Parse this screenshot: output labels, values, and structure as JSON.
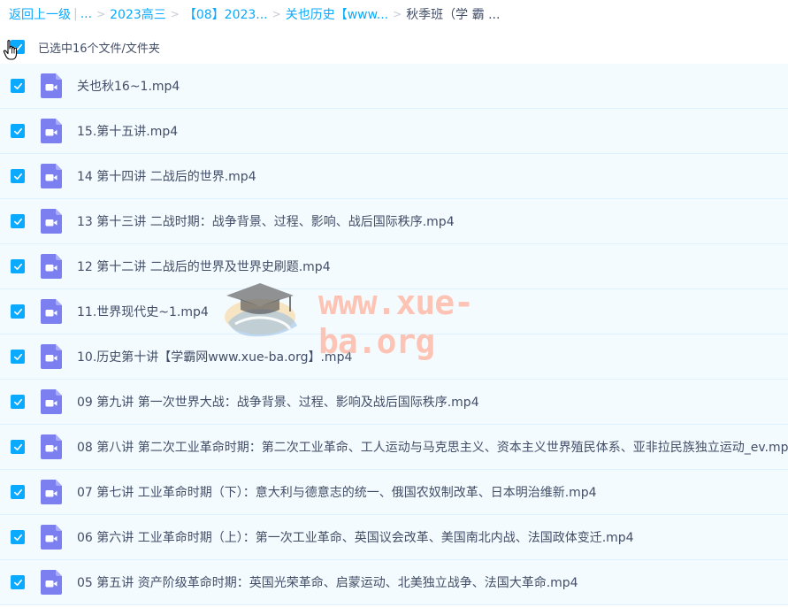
{
  "breadcrumb": {
    "back_label": "返回上一级",
    "ellipsis": "...",
    "items": [
      "2023高三",
      "【08】2023...",
      "关也历史【www..."
    ],
    "current": "秋季班（学 霸 ..."
  },
  "selection": {
    "label": "已选中16个文件/文件夹"
  },
  "files": [
    {
      "name": "关也秋16~1.mp4"
    },
    {
      "name": "15.第十五讲.mp4"
    },
    {
      "name": "14 第十四讲 二战后的世界.mp4"
    },
    {
      "name": "13 第十三讲 二战时期：战争背景、过程、影响、战后国际秩序.mp4"
    },
    {
      "name": "12 第十二讲 二战后的世界及世界史刷题.mp4"
    },
    {
      "name": "11.世界现代史~1.mp4"
    },
    {
      "name": "10.历史第十讲【学霸网www.xue-ba.org】.mp4"
    },
    {
      "name": "09 第九讲 第一次世界大战：战争背景、过程、影响及战后国际秩序.mp4"
    },
    {
      "name": "08 第八讲 第二次工业革命时期：第二次工业革命、工人运动与马克思主义、资本主义世界殖民体系、亚非拉民族独立运动_ev.mp4"
    },
    {
      "name": "07 第七讲 工业革命时期（下）：意大利与德意志的统一、俄国农奴制改革、日本明治维新.mp4"
    },
    {
      "name": "06 第六讲 工业革命时期（上）：第一次工业革命、英国议会改革、美国南北内战、法国政体变迁.mp4"
    },
    {
      "name": "05 第五讲 资产阶级革命时期：英国光荣革命、启蒙运动、北美独立战争、法国大革命.mp4"
    }
  ],
  "watermark": {
    "text": "www.xue-ba.org"
  },
  "icons": {
    "checkbox": "checkmark-icon",
    "file": "video-file-icon",
    "cursor": "hand-pointer-icon"
  },
  "colors": {
    "accent": "#09aaff",
    "row_bg": "#f4fbff",
    "row_border": "#ddf1fe",
    "video_icon": "#7b7ff0",
    "text": "#424e67"
  }
}
